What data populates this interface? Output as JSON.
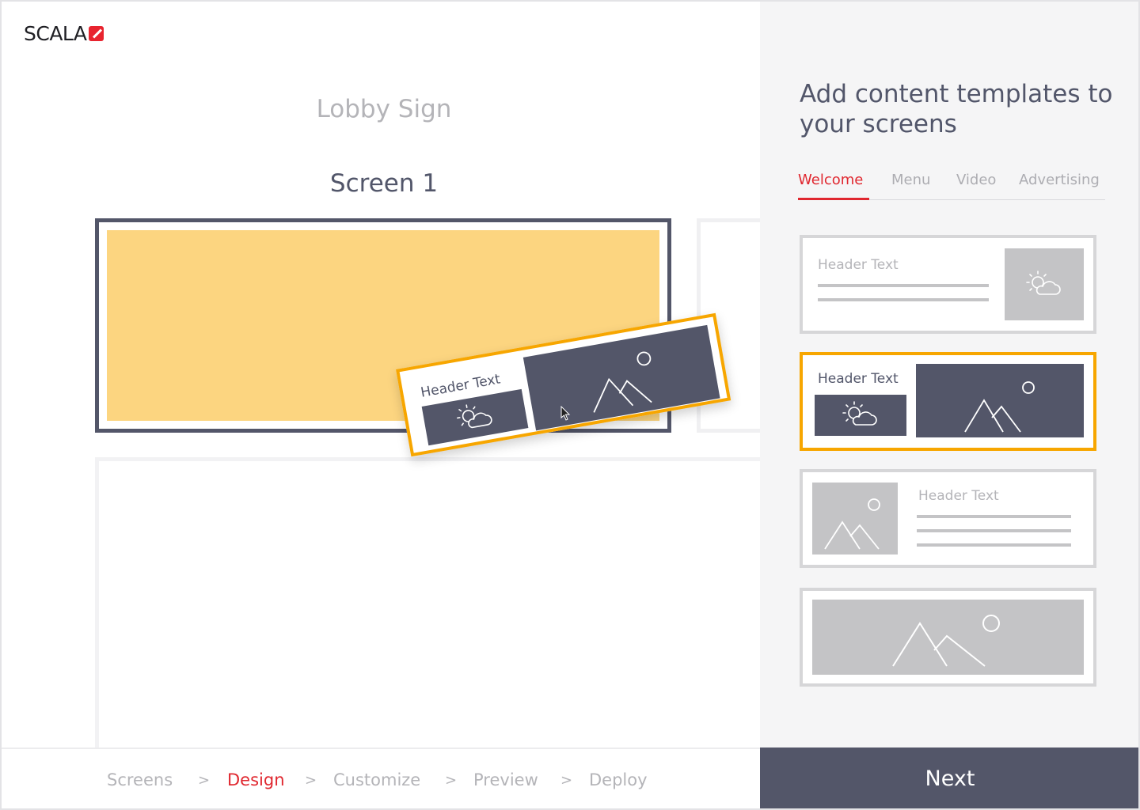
{
  "app": {
    "logo_text": "SCALA"
  },
  "canvas": {
    "sign_title": "Lobby Sign",
    "screen_title": "Screen 1",
    "dragged_template": {
      "header": "Header Text"
    }
  },
  "panel": {
    "title": "Add content templates to your screens",
    "tabs": [
      {
        "label": "Welcome",
        "active": true
      },
      {
        "label": "Menu"
      },
      {
        "label": "Video"
      },
      {
        "label": "Advertising"
      }
    ],
    "templates": [
      {
        "header": "Header Text"
      },
      {
        "header": "Header Text",
        "selected": true
      },
      {
        "header": "Header Text"
      },
      {
        "header": ""
      }
    ]
  },
  "footer": {
    "steps": [
      {
        "label": "Screens"
      },
      {
        "label": "Design",
        "active": true
      },
      {
        "label": "Customize"
      },
      {
        "label": "Preview"
      },
      {
        "label": "Deploy"
      }
    ],
    "separator": ">",
    "next_label": "Next"
  },
  "colors": {
    "accent_red": "#e0272f",
    "selection_orange": "#f7a600",
    "slate": "#535669",
    "screen_fill": "#fcd580"
  },
  "icons": [
    "weather-icon",
    "image-icon",
    "cursor-icon"
  ]
}
